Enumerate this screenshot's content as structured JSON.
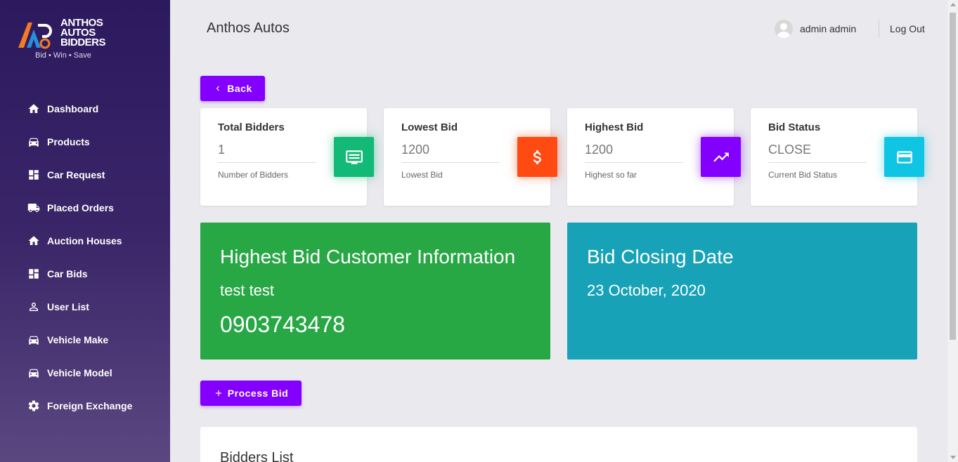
{
  "logo": {
    "line1": "ANTHOS",
    "line2": "AUTOS",
    "line3": "BIDDERS",
    "tagline": "Bid • Win • Save"
  },
  "sidebar": {
    "items": [
      {
        "label": "Dashboard",
        "icon": "home-icon"
      },
      {
        "label": "Products",
        "icon": "car-icon"
      },
      {
        "label": "Car Request",
        "icon": "grid-icon"
      },
      {
        "label": "Placed Orders",
        "icon": "truck-icon"
      },
      {
        "label": "Auction Houses",
        "icon": "home-icon"
      },
      {
        "label": "Car Bids",
        "icon": "grid-icon"
      },
      {
        "label": "User List",
        "icon": "user-icon"
      },
      {
        "label": "Vehicle Make",
        "icon": "car-icon"
      },
      {
        "label": "Vehicle Model",
        "icon": "car-icon"
      },
      {
        "label": "Foreign Exchange",
        "icon": "gear-icon"
      }
    ]
  },
  "header": {
    "brand": "Anthos Autos",
    "user_name": "admin admin",
    "logout": "Log Out"
  },
  "buttons": {
    "back": "Back",
    "process_bid": "Process Bid"
  },
  "stats": [
    {
      "title": "Total Bidders",
      "value": "1",
      "sub": "Number of Bidders",
      "icon": "monitor-icon",
      "color": "#13b977"
    },
    {
      "title": "Lowest Bid",
      "value": "1200",
      "sub": "Lowest Bid",
      "icon": "dollar-icon",
      "color": "#ff4a12"
    },
    {
      "title": "Highest Bid",
      "value": "1200",
      "sub": "Highest so far",
      "icon": "trending-up-icon",
      "color": "#8300ff"
    },
    {
      "title": "Bid Status",
      "value": "CLOSE",
      "sub": "Current Bid Status",
      "icon": "credit-card-icon",
      "color": "#10c5e3"
    }
  ],
  "customer_panel": {
    "title": "Highest Bid Customer Information",
    "name": "test test",
    "phone": "0903743478",
    "color": "#28a745"
  },
  "closing_panel": {
    "title": "Bid Closing Date",
    "date": "23 October, 2020",
    "color": "#17a2b8"
  },
  "bidders_list": {
    "title": "Bidders List"
  }
}
